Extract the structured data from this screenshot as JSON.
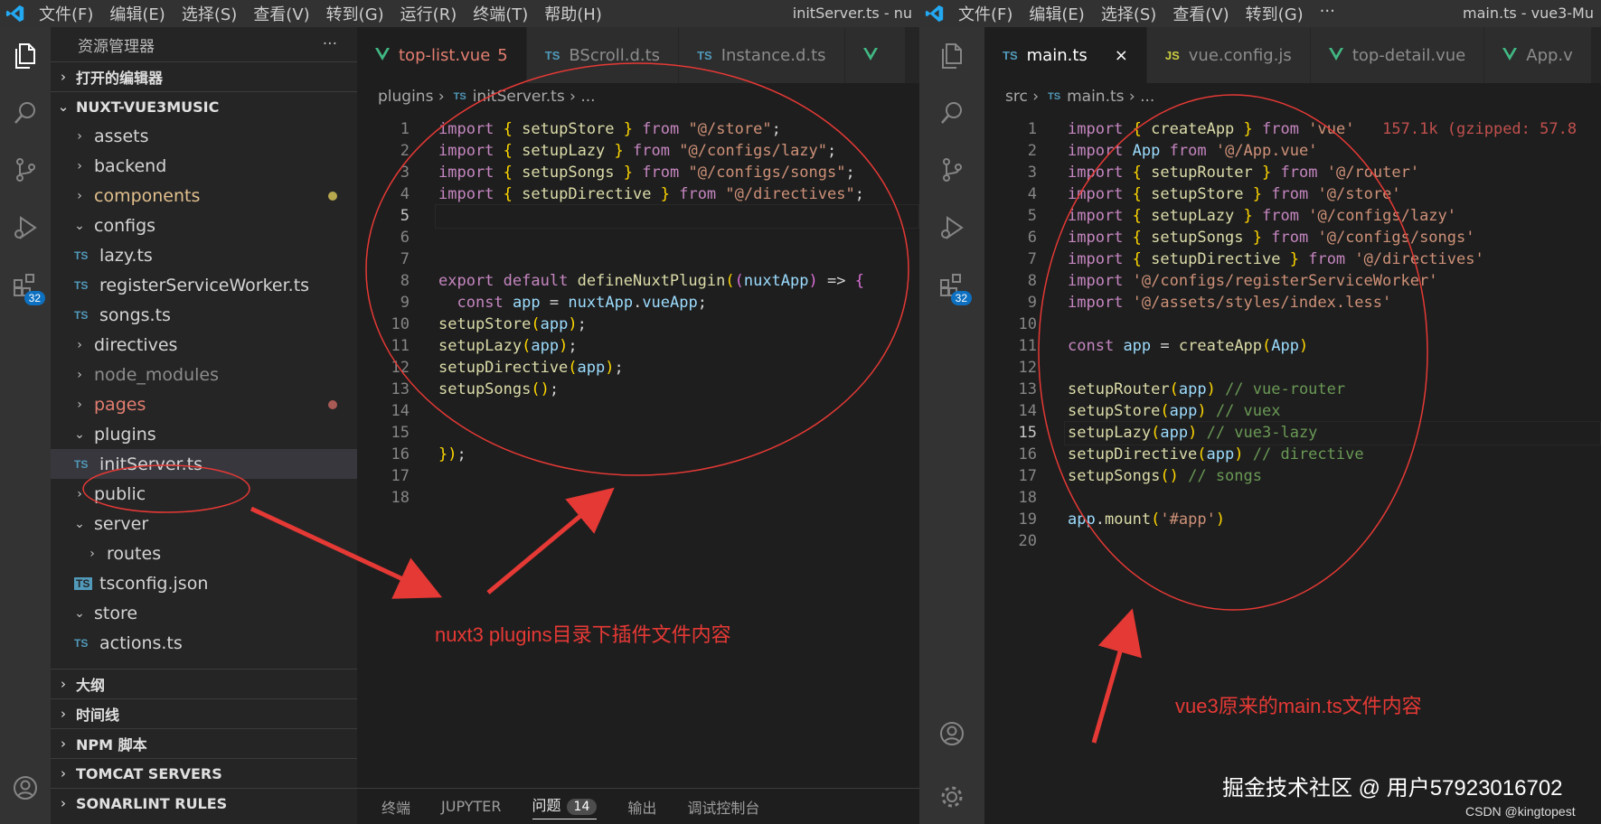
{
  "left_window": {
    "menu": [
      "文件(F)",
      "编辑(E)",
      "选择(S)",
      "查看(V)",
      "转到(G)",
      "运行(R)",
      "终端(T)",
      "帮助(H)"
    ],
    "title": "initServer.ts - nu",
    "extensions_badge": "32",
    "explorer": {
      "header": "资源管理器",
      "more": "···",
      "open_editors": "打开的编辑器",
      "project": "NUXT-VUE3MUSIC",
      "tree": [
        {
          "name": "assets",
          "type": "folder",
          "open": false
        },
        {
          "name": "backend",
          "type": "folder",
          "open": false
        },
        {
          "name": "components",
          "type": "folder",
          "open": false,
          "color": "#e2c08d",
          "dot": "#b8a84e"
        },
        {
          "name": "configs",
          "type": "folder",
          "open": true
        },
        {
          "name": "lazy.ts",
          "type": "ts",
          "indent": true
        },
        {
          "name": "registerServiceWorker.ts",
          "type": "ts",
          "indent": true
        },
        {
          "name": "songs.ts",
          "type": "ts",
          "indent": true
        },
        {
          "name": "directives",
          "type": "folder",
          "open": false
        },
        {
          "name": "node_modules",
          "type": "folder",
          "open": false,
          "color": "#8c8c8c"
        },
        {
          "name": "pages",
          "type": "folder",
          "open": false,
          "color": "#e37e6f",
          "dot": "#a85a55"
        },
        {
          "name": "plugins",
          "type": "folder",
          "open": true
        },
        {
          "name": "initServer.ts",
          "type": "ts",
          "indent": true,
          "selected": true
        },
        {
          "name": "public",
          "type": "folder",
          "open": false
        },
        {
          "name": "server",
          "type": "folder",
          "open": true
        },
        {
          "name": "routes",
          "type": "folder",
          "open": false,
          "indent": true
        },
        {
          "name": "tsconfig.json",
          "type": "tsconfig",
          "indent": true
        },
        {
          "name": "store",
          "type": "folder",
          "open": true
        },
        {
          "name": "actions.ts",
          "type": "ts",
          "indent": true
        }
      ],
      "bottom_sections": [
        "大纲",
        "时间线",
        "NPM 脚本",
        "TOMCAT SERVERS",
        "SONARLINT RULES"
      ]
    },
    "tabs": [
      {
        "label": "top-list.vue",
        "icon": "vue-icon",
        "count": "5",
        "active": true
      },
      {
        "label": "BScroll.d.ts",
        "icon": "TS",
        "active": false
      },
      {
        "label": "Instance.d.ts",
        "icon": "TS",
        "active": false
      },
      {
        "label": "",
        "icon": "vue-icon",
        "active": false
      }
    ],
    "breadcrumb": [
      "plugins",
      "initServer.ts",
      "..."
    ],
    "current_line": 5,
    "code": [
      "import { setupStore } from \"@/store\";",
      "import { setupLazy } from \"@/configs/lazy\";",
      "import { setupSongs } from \"@/configs/songs\";",
      "import { setupDirective } from \"@/directives\";",
      "",
      "",
      "",
      "export default defineNuxtPlugin((nuxtApp) => {",
      "  const app = nuxtApp.vueApp;",
      "setupStore(app);",
      "setupLazy(app);",
      "setupDirective(app);",
      "setupSongs();",
      "",
      "",
      "});",
      "",
      ""
    ],
    "panel_tabs": [
      "终端",
      "JUPYTER",
      "问题",
      "输出",
      "调试控制台"
    ],
    "panel_active": "问题",
    "problems_count": "14",
    "annotation": "nuxt3 plugins目录下插件文件内容"
  },
  "right_window": {
    "menu": [
      "文件(F)",
      "编辑(E)",
      "选择(S)",
      "查看(V)",
      "转到(G)",
      "···"
    ],
    "title": "main.ts - vue3-Mu",
    "extensions_badge": "32",
    "tabs": [
      {
        "label": "main.ts",
        "icon": "TS",
        "active": true,
        "close": "×"
      },
      {
        "label": "vue.config.js",
        "icon": "JS",
        "active": false
      },
      {
        "label": "top-detail.vue",
        "icon": "vue-icon",
        "active": false
      },
      {
        "label": "App.v",
        "icon": "vue-icon",
        "active": false
      }
    ],
    "breadcrumb": [
      "src",
      "main.ts",
      "..."
    ],
    "current_line": 15,
    "import_cost": "157.1k (gzipped: 57.8",
    "code": [
      "import { createApp } from 'vue'",
      "import App from '@/App.vue'",
      "import { setupRouter } from '@/router'",
      "import { setupStore } from '@/store'",
      "import { setupLazy } from '@/configs/lazy'",
      "import { setupSongs } from '@/configs/songs'",
      "import { setupDirective } from '@/directives'",
      "import '@/configs/registerServiceWorker'",
      "import '@/assets/styles/index.less'",
      "",
      "const app = createApp(App)",
      "",
      "setupRouter(app) // vue-router",
      "setupStore(app) // vuex",
      "setupLazy(app) // vue3-lazy",
      "setupDirective(app) // directive",
      "setupSongs() // songs",
      "",
      "app.mount('#app')",
      ""
    ],
    "annotation": "vue3原来的main.ts文件内容",
    "watermark": "掘金技术社区 @ 用户57923016702",
    "credit": "CSDN @kingtopest"
  },
  "colors": {
    "annotation_red": "#e53935",
    "badge_blue": "#0e70c0",
    "accent": "#007acc"
  }
}
